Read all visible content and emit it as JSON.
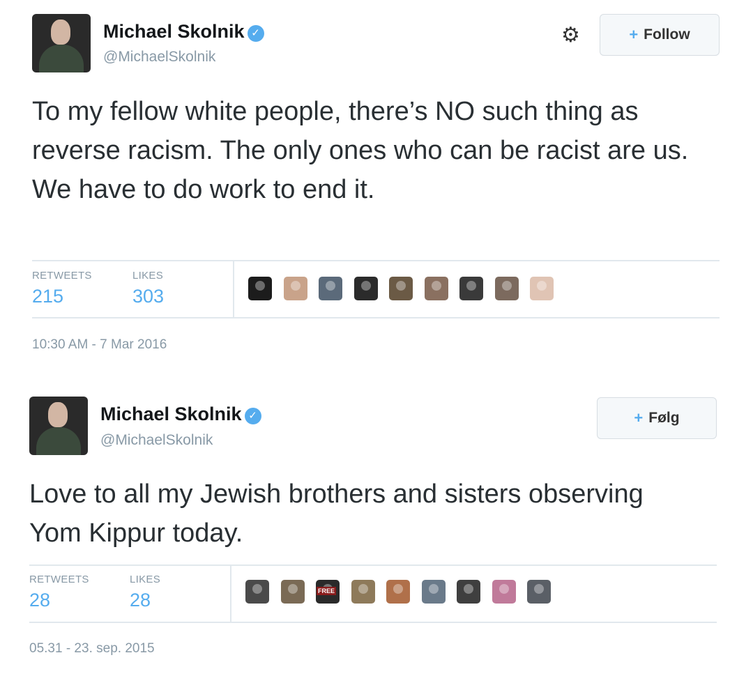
{
  "tweets": [
    {
      "author_name": "Michael Skolnik",
      "author_handle": "@MichaelSkolnik",
      "verified_glyph": "✓",
      "follow_label": "Follow",
      "follow_icon": "+",
      "settings_glyph": "⚙",
      "text": "To my fellow white people, there’s NO such thing as reverse racism. The only ones who can be racist are us. We have to do work to end it.",
      "retweets_label": "RETWEETS",
      "retweets": "215",
      "likes_label": "LIKES",
      "likes": "303",
      "liker_colors": [
        "#1c1c1c",
        "#c9a38a",
        "#5b6a7a",
        "#2b2b2b",
        "#6b5a45",
        "#8a7060",
        "#3a3a3a",
        "#7c6a5e",
        "#e0c4b4"
      ],
      "timestamp": "10:30 AM - 7 Mar 2016"
    },
    {
      "author_name": "Michael Skolnik",
      "author_handle": "@MichaelSkolnik",
      "verified_glyph": "✓",
      "follow_label": "Følg",
      "follow_icon": "+",
      "text": "Love to all my Jewish brothers and sisters observing Yom Kippur today.",
      "retweets_label": "RETWEETS",
      "retweets": "28",
      "likes_label": "LIKES",
      "likes": "28",
      "liker_colors": [
        "#4a4a4a",
        "#7a6a55",
        "#2a2a2a",
        "#8e7a5a",
        "#b0704a",
        "#6a7a8a",
        "#3f3f3f",
        "#c07a9a",
        "#5a5f66"
      ],
      "liker_badge": "FREE",
      "timestamp": "05.31 - 23. sep. 2015"
    }
  ]
}
